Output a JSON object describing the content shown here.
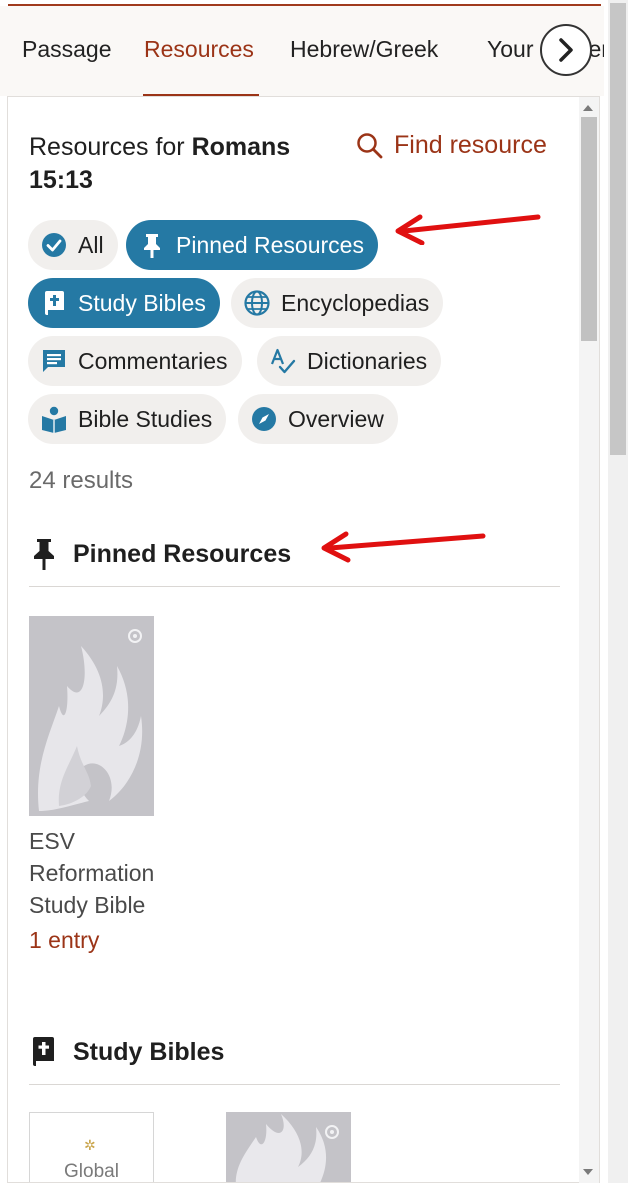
{
  "tabs": [
    {
      "label": "Passage",
      "active": false
    },
    {
      "label": "Resources",
      "active": true
    },
    {
      "label": "Hebrew/Greek",
      "active": false
    },
    {
      "label": "Your Content",
      "active": false
    }
  ],
  "heading": {
    "prefix": "Resources for ",
    "reference": "Romans 15:13"
  },
  "find_resource": "Find resource",
  "filters": [
    {
      "label": "All",
      "icon": "check-circle-icon",
      "selected": false
    },
    {
      "label": "Pinned Resources",
      "icon": "pin-icon",
      "selected": true
    },
    {
      "label": "Study Bibles",
      "icon": "bible-icon",
      "selected": true
    },
    {
      "label": "Encyclopedias",
      "icon": "globe-icon",
      "selected": false
    },
    {
      "label": "Commentaries",
      "icon": "comment-icon",
      "selected": false
    },
    {
      "label": "Dictionaries",
      "icon": "spellcheck-icon",
      "selected": false
    },
    {
      "label": "Bible Studies",
      "icon": "reader-icon",
      "selected": false
    },
    {
      "label": "Overview",
      "icon": "compass-icon",
      "selected": false
    }
  ],
  "results_count": "24 results",
  "sections": [
    {
      "title": "Pinned Resources",
      "icon": "pin-icon",
      "items": [
        {
          "title": "ESV Reformation Study Bible",
          "entries": "1 entry",
          "cover": "gray-flame-cover"
        }
      ]
    },
    {
      "title": "Study Bibles",
      "icon": "bible-icon",
      "items": [
        {
          "cover_text": "Global",
          "cover": "white-cover"
        },
        {
          "cover": "gray-flame-cover"
        }
      ]
    }
  ],
  "colors": {
    "accent": "#9b3417",
    "chip_selected": "#2579a4",
    "chip_bg": "#f1efed",
    "annotation_arrow": "#e01010"
  }
}
